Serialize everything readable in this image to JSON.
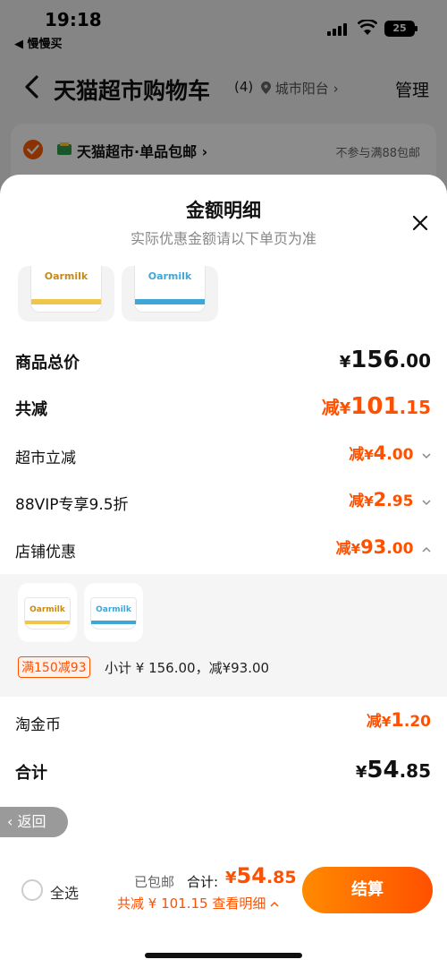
{
  "status_bar": {
    "time": "19:18",
    "back_app": "◀ 慢慢买",
    "battery": "25"
  },
  "nav": {
    "title": "天猫超市购物车",
    "count": "(4)",
    "location": "城市阳台",
    "manage": "管理"
  },
  "store": {
    "name": "天猫超市·单品包邮",
    "note": "不参与满88包邮"
  },
  "sheet": {
    "title": "金额明细",
    "subtitle": "实际优惠金额请以下单页为准",
    "product_brand": "Oarmilk",
    "rows": {
      "goods_total": {
        "label": "商品总价",
        "symbol": "¥",
        "int": "156",
        "dec": ".00"
      },
      "total_discount": {
        "label": "共减",
        "prefix": "减",
        "symbol": "¥",
        "int": "101",
        "dec": ".15"
      },
      "supermarket": {
        "label": "超市立减",
        "prefix": "减",
        "symbol": "¥",
        "int": "4",
        "dec": ".00"
      },
      "vip": {
        "label": "88VIP专享9.5折",
        "prefix": "减",
        "symbol": "¥",
        "int": "2",
        "dec": ".95"
      },
      "store_promo": {
        "label": "店铺优惠",
        "prefix": "减",
        "symbol": "¥",
        "int": "93",
        "dec": ".00"
      },
      "coins": {
        "label": "淘金币",
        "prefix": "减",
        "symbol": "¥",
        "int": "1",
        "dec": ".20"
      },
      "sum": {
        "label": "合计",
        "symbol": "¥",
        "int": "54",
        "dec": ".85"
      }
    },
    "promo": {
      "tag": "满150减93",
      "text": "小计 ¥ 156.00，减¥93.00"
    },
    "back_button": "返回"
  },
  "bottom_bar": {
    "select_all": "全选",
    "shipped": "已包邮",
    "total_label": "合计:",
    "total_symbol": "¥",
    "total_int": "54",
    "total_dec": ".85",
    "saved": "共减 ¥ 101.15  查看明细",
    "checkout": "结算"
  },
  "colors": {
    "accent": "#ff5000",
    "accent_light": "#ff8a00",
    "yellow_band": "#f0c64a",
    "blue_brand": "#3fa6d6"
  }
}
